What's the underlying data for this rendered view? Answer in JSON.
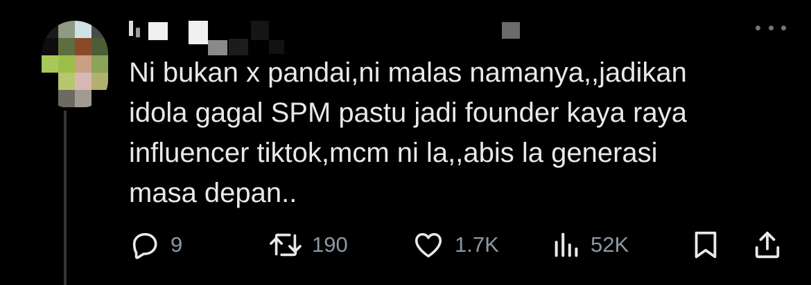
{
  "tweet": {
    "text": "Ni bukan x pandai,ni malas namanya,,jadikan\nidola gagal SPM pastu jadi founder kaya raya\ninfluencer tiktok,mcm ni la,,abis la generasi\nmasa depan..",
    "more_icon": "more-horizontal-icon",
    "colors": {
      "text": "#e7e9ea",
      "muted": "#71767b",
      "background": "#000000"
    }
  },
  "actions": {
    "reply": {
      "icon": "reply-icon",
      "count": "9"
    },
    "retweet": {
      "icon": "retweet-icon",
      "count": "190"
    },
    "like": {
      "icon": "heart-icon",
      "count": "1.7K"
    },
    "views": {
      "icon": "views-icon",
      "count": "52K"
    },
    "bookmark": {
      "icon": "bookmark-icon"
    },
    "share": {
      "icon": "share-icon"
    }
  }
}
